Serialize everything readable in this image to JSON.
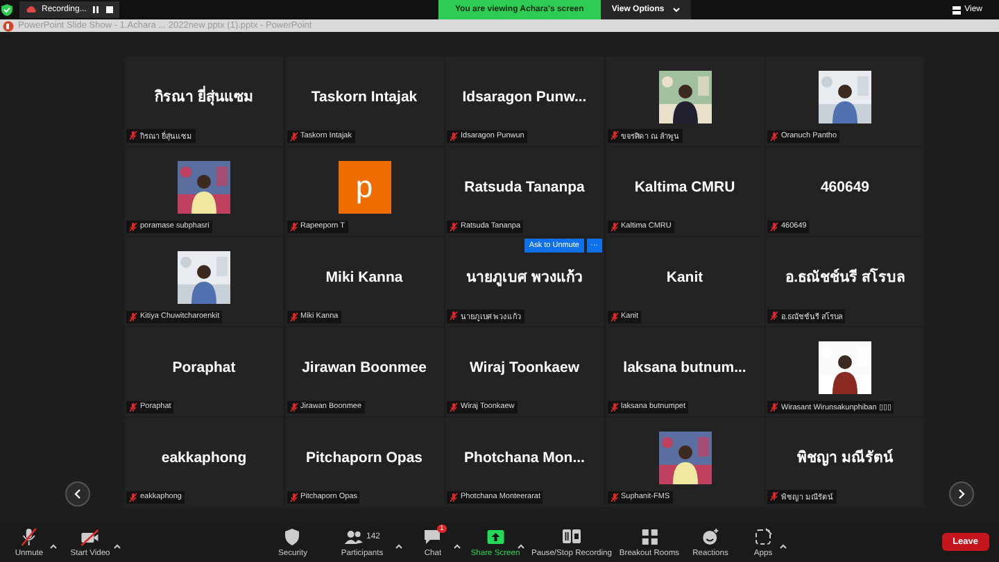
{
  "top_bar": {
    "recording": {
      "label": "Recording...",
      "paused": false
    },
    "banner": "You are viewing Achara's screen",
    "view_options": "View Options",
    "view": "View"
  },
  "window": {
    "title": "PowerPoint Slide Show - 1.Achara ... 2022new pptx (1).pptx - PowerPoint"
  },
  "tiles": [
    {
      "kind": "name",
      "display": "กิรณา ยี่สุ่นแซม",
      "label": "กิรณา ยี่สุ่นแซม"
    },
    {
      "kind": "name",
      "display": "Taskorn Intajak",
      "label": "Taskorn Intajak"
    },
    {
      "kind": "name",
      "display": "Idsaragon  Punw...",
      "label": "Idsaragon Punwun"
    },
    {
      "kind": "picture",
      "label": "ขจรศิดา ณ ลำพูน"
    },
    {
      "kind": "picture",
      "label": "Oranuch Pantho"
    },
    {
      "kind": "picture",
      "label": "poramase subphasri"
    },
    {
      "kind": "letter",
      "display": "p",
      "label": "Rapeeporn T"
    },
    {
      "kind": "name",
      "display": "Ratsuda Tananpa",
      "label": "Ratsuda Tananpa"
    },
    {
      "kind": "name",
      "display": "Kaltima CMRU",
      "label": "Kaltima CMRU"
    },
    {
      "kind": "name",
      "display": "460649",
      "label": "460649"
    },
    {
      "kind": "picture",
      "label": "Kitiya Chuwitcharoenkit"
    },
    {
      "kind": "name",
      "display": "Miki  Kanna",
      "label": "Miki  Kanna"
    },
    {
      "kind": "name",
      "display": "นายภูเบศ พวงแก้ว",
      "label": "นายภูเบศ พวงแก้ว",
      "actions": [
        "Ask to Unmute",
        "···"
      ]
    },
    {
      "kind": "name",
      "display": "Kanit",
      "label": "Kanit"
    },
    {
      "kind": "name",
      "display": "อ.ธณัชช์นรี สโรบล",
      "label": "อ.ธณัชช์นรี สโรบล"
    },
    {
      "kind": "name",
      "display": "Poraphat",
      "label": "Poraphat"
    },
    {
      "kind": "name",
      "display": "Jirawan Boonmee",
      "label": "Jirawan Boonmee"
    },
    {
      "kind": "name",
      "display": "Wiraj Toonkaew",
      "label": "Wiraj Toonkaew"
    },
    {
      "kind": "name",
      "display": "laksana  butnum...",
      "label": "laksana butnumpet"
    },
    {
      "kind": "picture",
      "label": "Wirasant Wirunsakunphiban ▯▯▯"
    },
    {
      "kind": "name",
      "display": "eakkaphong",
      "label": "eakkaphong"
    },
    {
      "kind": "name",
      "display": "Pitchaporn Opas",
      "label": "Pitchaporn Opas"
    },
    {
      "kind": "name",
      "display": "Photchana  Mon...",
      "label": "Photchana Monteerarat"
    },
    {
      "kind": "picture",
      "label": "Suphanit-FMS"
    },
    {
      "kind": "name",
      "display": "พิชญา มณีรัตน์",
      "label": "พิชญา มณีรัตน์"
    }
  ],
  "toolbar": [
    {
      "kind": "mic",
      "label": "Unmute",
      "caret": true,
      "off": true
    },
    {
      "kind": "video",
      "label": "Start Video",
      "caret": true,
      "off": true
    },
    {
      "kind": "security",
      "label": "Security",
      "caret": false
    },
    {
      "kind": "participants",
      "label": "Participants",
      "count": "142",
      "caret": true
    },
    {
      "kind": "chat",
      "label": "Chat",
      "badge": "1",
      "caret": true
    },
    {
      "kind": "share",
      "label": "Share Screen",
      "caret": true
    },
    {
      "kind": "record",
      "label": "Pause/Stop Recording",
      "caret": false
    },
    {
      "kind": "rooms",
      "label": "Breakout Rooms",
      "caret": false
    },
    {
      "kind": "reactions",
      "label": "Reactions",
      "caret": false
    },
    {
      "kind": "apps",
      "label": "Apps",
      "caret": true
    }
  ],
  "leave": "Leave"
}
